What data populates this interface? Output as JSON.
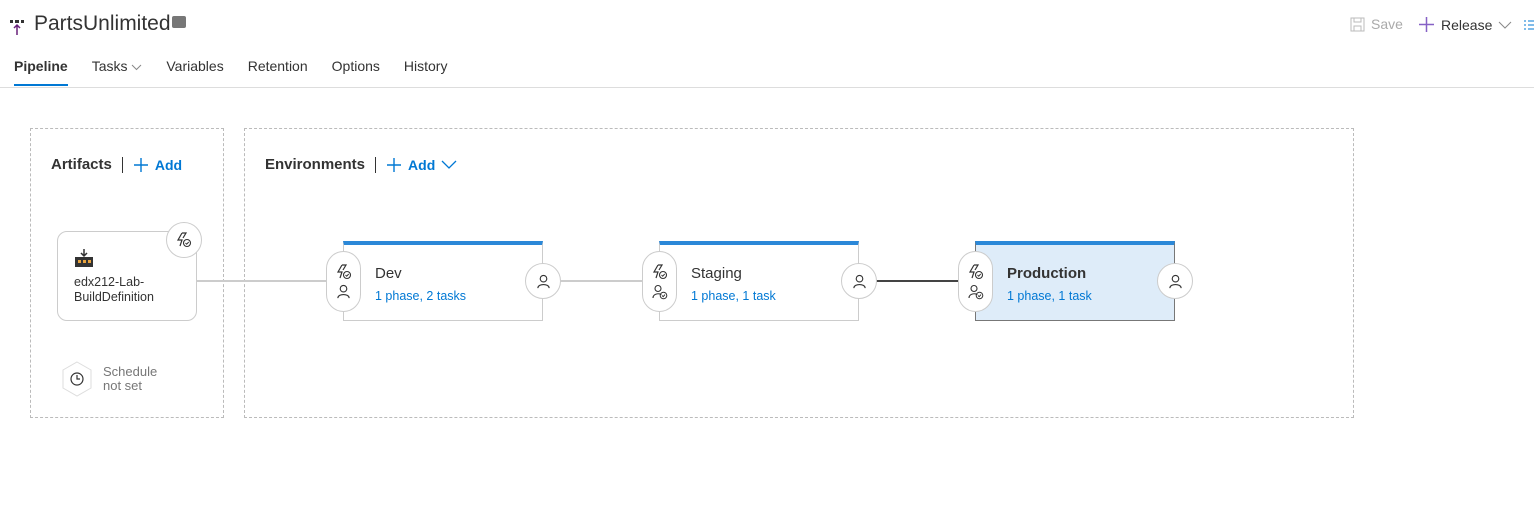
{
  "header": {
    "title": "PartsUnlimited",
    "save_label": "Save",
    "release_label": "Release"
  },
  "tabs": [
    {
      "label": "Pipeline",
      "active": true
    },
    {
      "label": "Tasks"
    },
    {
      "label": "Variables"
    },
    {
      "label": "Retention"
    },
    {
      "label": "Options"
    },
    {
      "label": "History"
    }
  ],
  "artifacts": {
    "heading": "Artifacts",
    "add_label": "Add",
    "items": [
      {
        "name_line1": "edx212-Lab-",
        "name_line2": "BuildDefinition"
      }
    ],
    "schedule_line1": "Schedule",
    "schedule_line2": "not set"
  },
  "environments": {
    "heading": "Environments",
    "add_label": "Add",
    "items": [
      {
        "name": "Dev",
        "summary": "1 phase, 2 tasks"
      },
      {
        "name": "Staging",
        "summary": "1 phase, 1 task"
      },
      {
        "name": "Production",
        "summary": "1 phase, 1 task",
        "selected": true
      }
    ]
  },
  "colors": {
    "accent": "#0078d4",
    "env_bar": "#2b88d8",
    "selected_bg": "#deecf9"
  }
}
